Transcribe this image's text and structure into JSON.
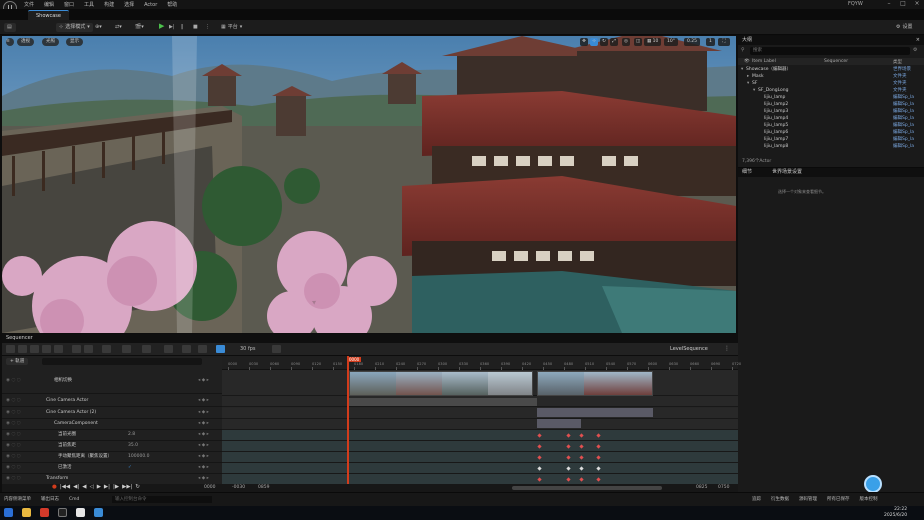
{
  "menubar": {
    "items": [
      "文件",
      "编辑",
      "窗口",
      "工具",
      "构建",
      "选择",
      "Actor",
      "帮助"
    ],
    "project": "FQYW"
  },
  "tab": {
    "label": "Showcase"
  },
  "toolbar": {
    "mode": "选择模式",
    "platform": "平台",
    "settings": "设置"
  },
  "viewport": {
    "perspective": "透视",
    "lit": "光照",
    "show": "显示",
    "snap_angle": "10°",
    "snap_scale": "0.25",
    "cam_speed": "1"
  },
  "outliner": {
    "title": "大纲",
    "search_placeholder": "搜索",
    "col_label": "Item Label",
    "col_seq": "Sequencer",
    "col_type": "类型",
    "rows": [
      {
        "label": "Showcase（编辑器）",
        "type": "世界场景"
      },
      {
        "label": "Mask",
        "type": "文件夹"
      },
      {
        "label": "SF",
        "type": "文件夹"
      },
      {
        "label": "SF_DongLong",
        "type": "文件夹"
      },
      {
        "label": "lijiu_lamp",
        "type": "编辑Sp_la"
      },
      {
        "label": "lijiu_lamp2",
        "type": "编辑Sp_la"
      },
      {
        "label": "lijiu_lamp3",
        "type": "编辑Sp_la"
      },
      {
        "label": "lijiu_lamp4",
        "type": "编辑Sp_la"
      },
      {
        "label": "lijiu_lamp5",
        "type": "编辑Sp_la"
      },
      {
        "label": "lijiu_lamp6",
        "type": "编辑Sp_la"
      },
      {
        "label": "lijiu_lamp7",
        "type": "编辑Sp_la"
      },
      {
        "label": "lijiu_lamp8",
        "type": "编辑Sp_la"
      }
    ],
    "count": "7,396个Actor"
  },
  "details": {
    "tab1": "细节",
    "tab2": "世界场景设置",
    "hint": "选择一个对象来查看细节。"
  },
  "sequencer": {
    "title": "Sequencer",
    "fps": "30 fps",
    "sequence_name": "LevelSequence",
    "playhead": "0000",
    "tracks": [
      {
        "label": "相机切换",
        "value": ""
      },
      {
        "label": "Cine Camera Actor",
        "value": ""
      },
      {
        "label": "Cine Camera Actor (2)",
        "value": ""
      },
      {
        "label": "CameraComponent",
        "value": ""
      },
      {
        "label": "当前光圈",
        "value": "2.8"
      },
      {
        "label": "当前焦距",
        "value": "35.0"
      },
      {
        "label": "手动聚焦距离（聚焦设置）",
        "value": "100000.0"
      },
      {
        "label": "已激活",
        "value": "✓"
      },
      {
        "label": "Transform",
        "value": ""
      }
    ],
    "ruler": [
      "0000",
      "0030",
      "0060",
      "0090",
      "0120",
      "0150",
      "0180",
      "0210",
      "0240",
      "0270",
      "0300",
      "0330",
      "0360",
      "0390",
      "0420",
      "0450",
      "0480",
      "0510",
      "0540",
      "0570",
      "0600",
      "0630",
      "0660",
      "0690",
      "0720"
    ],
    "foot_left": "-0030",
    "foot_left2": "0000",
    "foot_mid": "0859",
    "foot_right": "0825",
    "foot_right2": "0750",
    "add_track": "+ 轨道"
  },
  "statusbar": {
    "items": [
      "内容侧滑菜单",
      "输出日志",
      "Cmd"
    ],
    "cmd_placeholder": "输入控制台命令",
    "right": [
      "追踪",
      "衍生数据",
      "源码管理",
      "所有已保存",
      "版本控制"
    ]
  },
  "taskbar": {
    "time": "22:22",
    "date": "2025/6/20"
  },
  "colors": {
    "accent": "#3a8bd6",
    "playhead": "#d23c1c",
    "play": "#4cc24c"
  }
}
